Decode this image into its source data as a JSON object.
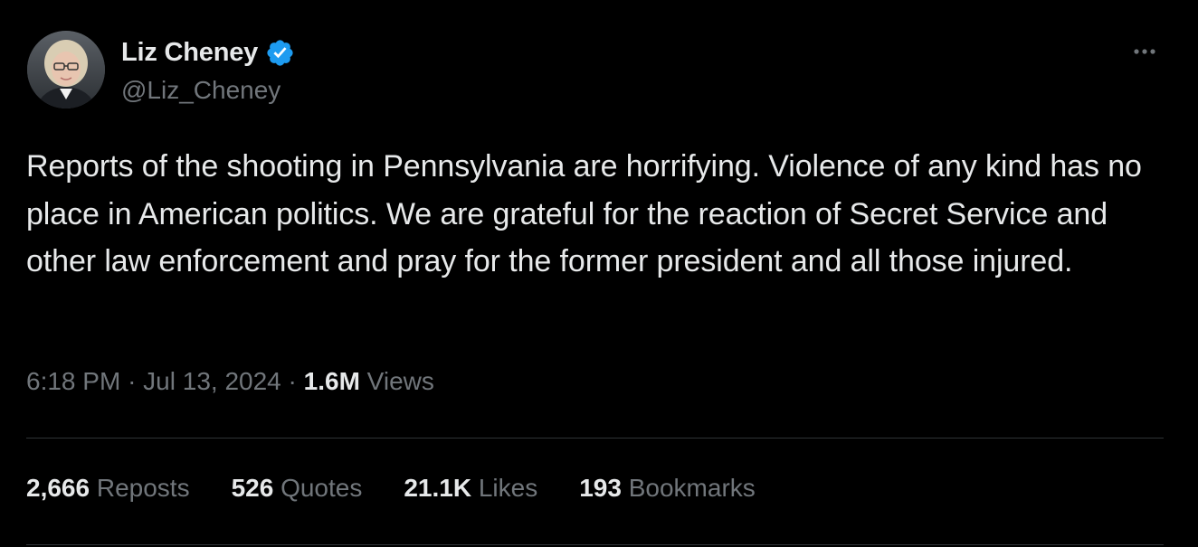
{
  "author": {
    "display_name": "Liz Cheney",
    "handle": "@Liz_Cheney",
    "verified": true,
    "verified_color": "#1d9bf0"
  },
  "tweet": {
    "text": "Reports of the shooting in Pennsylvania are horrifying. Violence of any kind has no place in American politics. We are grateful for the reaction of Secret Service and other law enforcement and pray for the former president and all those injured.",
    "time": "6:18 PM",
    "date": "Jul 13, 2024",
    "views_count": "1.6M",
    "views_label": "Views"
  },
  "stats": {
    "reposts": {
      "count": "2,666",
      "label": "Reposts"
    },
    "quotes": {
      "count": "526",
      "label": "Quotes"
    },
    "likes": {
      "count": "21.1K",
      "label": "Likes"
    },
    "bookmarks": {
      "count": "193",
      "label": "Bookmarks"
    }
  },
  "icons": {
    "more": "more-options-icon",
    "verified": "verified-badge-icon"
  },
  "colors": {
    "background": "#000000",
    "primary_text": "#e7e9ea",
    "secondary_text": "#71767b",
    "divider": "#2f3336",
    "accent": "#1d9bf0"
  }
}
